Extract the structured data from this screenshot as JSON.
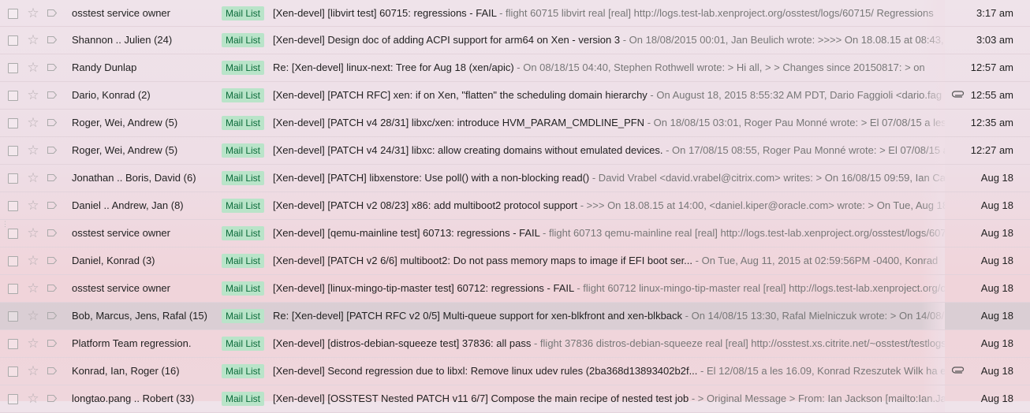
{
  "label_text": "Mail List",
  "icons": {
    "checkbox": "checkbox-icon",
    "star": "star-icon",
    "important": "importance-marker-icon",
    "attachment": "paperclip-icon"
  },
  "colors": {
    "label_bg": "#b9e4c9",
    "label_fg": "#0b6b3a"
  },
  "rows": [
    {
      "sender": "osstest service owner",
      "subject": "[Xen-devel] [libvirt test] 60715: regressions - FAIL",
      "snippet": " - flight 60715 libvirt real [real] http://logs.test-lab.xenproject.org/osstest/logs/60715/ Regressions",
      "date": "3:17 am",
      "attachment": false
    },
    {
      "sender": "Shannon .. Julien (24)",
      "subject": "[Xen-devel] Design doc of adding ACPI support for arm64 on Xen - version 3",
      "snippet": " - On 18/08/2015 00:01, Jan Beulich wrote: >>>> On 18.08.15 at 08:43, <",
      "date": "3:03 am",
      "attachment": false
    },
    {
      "sender": "Randy Dunlap",
      "subject": "Re: [Xen-devel] linux-next: Tree for Aug 18 (xen/apic)",
      "snippet": " - On 08/18/15 04:40, Stephen Rothwell wrote: > Hi all, > > Changes since 20150817: > on",
      "date": "12:57 am",
      "attachment": false
    },
    {
      "sender": "Dario, Konrad (2)",
      "subject": "[Xen-devel] [PATCH RFC] xen: if on Xen, \"flatten\" the scheduling domain hierarchy",
      "snippet": " - On August 18, 2015 8:55:32 AM PDT, Dario Faggioli <dario.fag",
      "date": "12:55 am",
      "attachment": true
    },
    {
      "sender": "Roger, Wei, Andrew (5)",
      "subject": "[Xen-devel] [PATCH v4 28/31] libxc/xen: introduce HVM_PARAM_CMDLINE_PFN",
      "snippet": " - On 18/08/15 03:01, Roger Pau Monné wrote: > El 07/08/15 a les",
      "date": "12:35 am",
      "attachment": false
    },
    {
      "sender": "Roger, Wei, Andrew (5)",
      "subject": "[Xen-devel] [PATCH v4 24/31] libxc: allow creating domains without emulated devices.",
      "snippet": " - On 17/08/15 08:55, Roger Pau Monné wrote: > El 07/08/15 a",
      "date": "12:27 am",
      "attachment": false
    },
    {
      "sender": "Jonathan .. Boris, David (6)",
      "subject": "[Xen-devel] [PATCH] libxenstore: Use poll() with a non-blocking read()",
      "snippet": " - David Vrabel <david.vrabel@citrix.com> writes: > On 16/08/15 09:59, Ian Cam",
      "date": "Aug 18",
      "attachment": false
    },
    {
      "sender": "Daniel .. Andrew, Jan (8)",
      "subject": "[Xen-devel] [PATCH v2 08/23] x86: add multiboot2 protocol support",
      "snippet": " - >>> On 18.08.15 at 14:00, <daniel.kiper@oracle.com> wrote: > On Tue, Aug 18",
      "date": "Aug 18",
      "attachment": false
    },
    {
      "sender": "osstest service owner",
      "subject": "[Xen-devel] [qemu-mainline test] 60713: regressions - FAIL",
      "snippet": " - flight 60713 qemu-mainline real [real] http://logs.test-lab.xenproject.org/osstest/logs/6071",
      "date": "Aug 18",
      "attachment": false
    },
    {
      "sender": "Daniel, Konrad (3)",
      "subject": "[Xen-devel] [PATCH v2 6/6] multiboot2: Do not pass memory maps to image if EFI boot ser...",
      "snippet": " - On Tue, Aug 11, 2015 at 02:59:56PM -0400, Konrad",
      "date": "Aug 18",
      "attachment": false
    },
    {
      "sender": "osstest service owner",
      "subject": "[Xen-devel] [linux-mingo-tip-master test] 60712: regressions - FAIL",
      "snippet": " - flight 60712 linux-mingo-tip-master real [real] http://logs.test-lab.xenproject.org/os",
      "date": "Aug 18",
      "attachment": false
    },
    {
      "sender": "Bob, Marcus, Jens, Rafal (15)",
      "subject": "Re: [Xen-devel] [PATCH RFC v2 0/5] Multi-queue support for xen-blkfront and xen-blkback",
      "snippet": " - On 14/08/15 13:30, Rafal Mielniczuk wrote: > On 14/08/1",
      "date": "Aug 18",
      "attachment": false
    },
    {
      "sender": "Platform Team regression.",
      "subject": "[Xen-devel] [distros-debian-squeeze test] 37836: all pass",
      "snippet": " - flight 37836 distros-debian-squeeze real [real] http://osstest.xs.citrite.net/~osstest/testlogs/lo",
      "date": "Aug 18",
      "attachment": false
    },
    {
      "sender": "Konrad, Ian, Roger (16)",
      "subject": "[Xen-devel] Second regression due to libxl: Remove linux udev rules (2ba368d13893402b2f...",
      "snippet": " - El 12/08/15 a les 16.09, Konrad Rzeszutek Wilk ha esc",
      "date": "Aug 18",
      "attachment": true
    },
    {
      "sender": "longtao.pang .. Robert (33)",
      "subject": "[Xen-devel] [OSSTEST Nested PATCH v11 6/7] Compose the main recipe of nested test job",
      "snippet": " - > Original Message > From: Ian Jackson [mailto:Ian.Ja",
      "date": "Aug 18",
      "attachment": false
    }
  ]
}
